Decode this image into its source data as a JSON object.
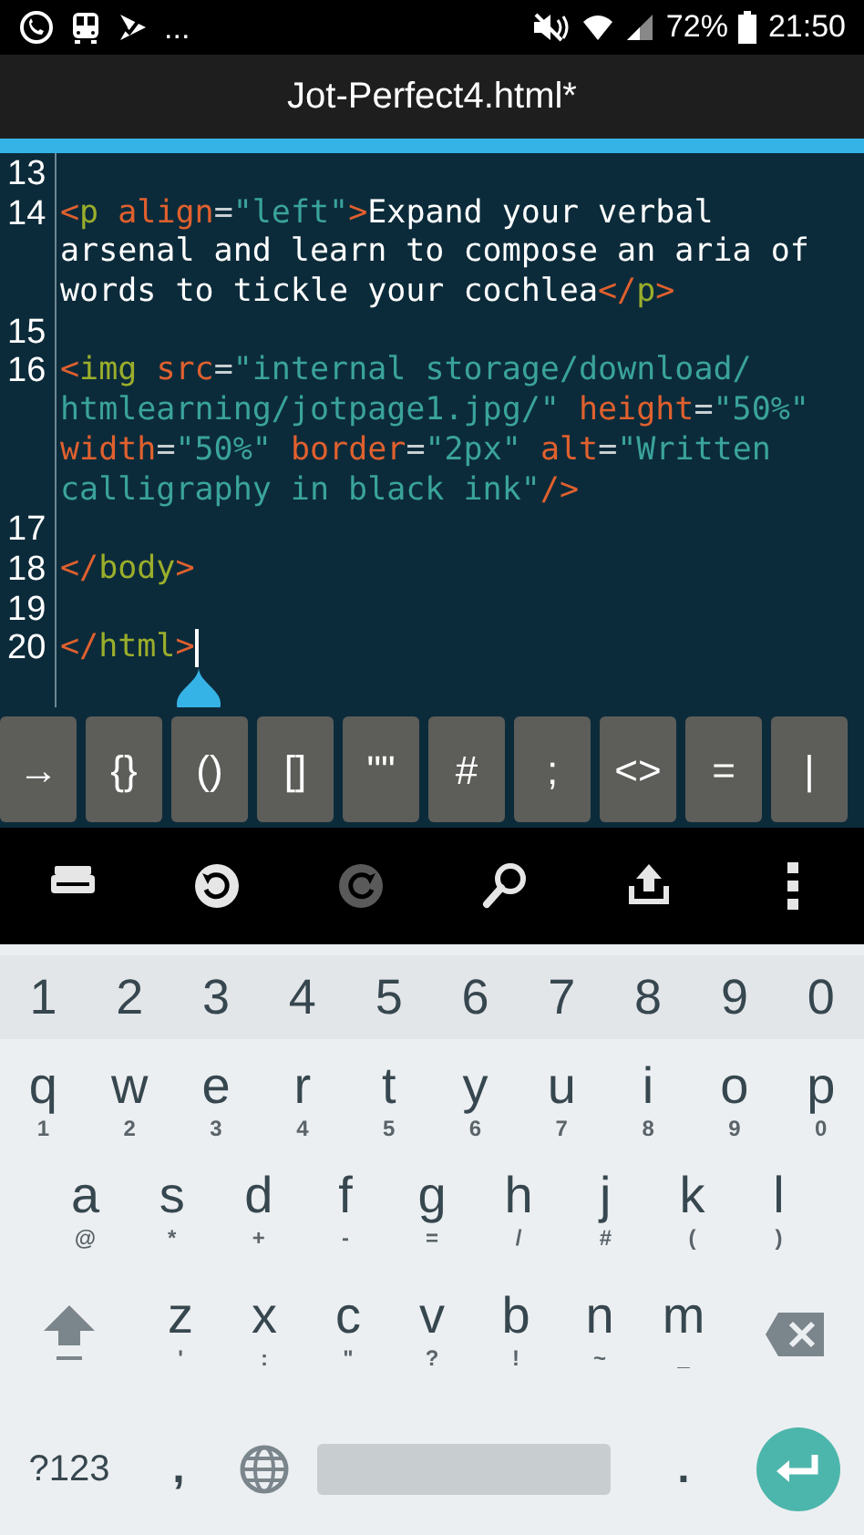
{
  "status_bar": {
    "overflow": "...",
    "battery": "72%",
    "time": "21:50"
  },
  "window": {
    "title": "Jot-Perfect4.html*"
  },
  "editor": {
    "lines": [
      {
        "number": "13"
      },
      {
        "number": "14",
        "wraps": [
          {
            "spans": [
              {
                "kind": "punct",
                "text": "<"
              },
              {
                "kind": "tag",
                "text": "p"
              },
              {
                "kind": "attr",
                "text": " align"
              },
              {
                "kind": "eq",
                "text": "="
              },
              {
                "kind": "value",
                "text": "\"left\""
              },
              {
                "kind": "punct",
                "text": ">"
              },
              {
                "kind": "text",
                "text": "Expand your verbal"
              }
            ]
          },
          {
            "spans": [
              {
                "kind": "text",
                "text": "arsenal and learn to compose an aria of"
              }
            ]
          },
          {
            "spans": [
              {
                "kind": "text",
                "text": "words to tickle your cochlea"
              },
              {
                "kind": "punct",
                "text": "</"
              },
              {
                "kind": "tag",
                "text": "p"
              },
              {
                "kind": "punct",
                "text": ">"
              }
            ]
          }
        ]
      },
      {
        "number": "15"
      },
      {
        "number": "16",
        "wraps": [
          {
            "spans": [
              {
                "kind": "punct",
                "text": "<"
              },
              {
                "kind": "tag",
                "text": "img"
              },
              {
                "kind": "attr",
                "text": " src"
              },
              {
                "kind": "eq",
                "text": "="
              },
              {
                "kind": "value",
                "text": "\"internal storage/download/"
              }
            ]
          },
          {
            "spans": [
              {
                "kind": "value",
                "text": "htmlearning/jotpage1.jpg/\""
              },
              {
                "kind": "attr",
                "text": " height"
              },
              {
                "kind": "eq",
                "text": "="
              },
              {
                "kind": "value",
                "text": "\"50%\""
              }
            ]
          },
          {
            "spans": [
              {
                "kind": "attr",
                "text": "width"
              },
              {
                "kind": "eq",
                "text": "="
              },
              {
                "kind": "value",
                "text": "\"50%\""
              },
              {
                "kind": "attr",
                "text": " border"
              },
              {
                "kind": "eq",
                "text": "="
              },
              {
                "kind": "value",
                "text": "\"2px\""
              },
              {
                "kind": "attr",
                "text": " alt"
              },
              {
                "kind": "eq",
                "text": "="
              },
              {
                "kind": "value",
                "text": "\"Written"
              }
            ]
          },
          {
            "spans": [
              {
                "kind": "value",
                "text": "calligraphy in black ink\""
              },
              {
                "kind": "punct",
                "text": "/>"
              }
            ]
          }
        ]
      },
      {
        "number": "17"
      },
      {
        "number": "18",
        "wraps": [
          {
            "spans": [
              {
                "kind": "punct",
                "text": "</"
              },
              {
                "kind": "tag",
                "text": "body"
              },
              {
                "kind": "punct",
                "text": ">"
              }
            ]
          }
        ]
      },
      {
        "number": "19"
      },
      {
        "number": "20",
        "wraps": [
          {
            "spans": [
              {
                "kind": "punct",
                "text": "</"
              },
              {
                "kind": "tag",
                "text": "html"
              },
              {
                "kind": "punct",
                "text": ">"
              }
            ]
          }
        ],
        "cursor": true
      }
    ]
  },
  "symbol_keys": [
    "→",
    "{}",
    "()",
    "[]",
    "\"\"",
    "#",
    ";",
    "<>",
    "=",
    "|"
  ],
  "toolbar": [
    {
      "kind": "drive",
      "disabled": false
    },
    {
      "kind": "undo",
      "disabled": false
    },
    {
      "kind": "redo",
      "disabled": true
    },
    {
      "kind": "search",
      "disabled": false
    },
    {
      "kind": "share",
      "disabled": false
    },
    {
      "kind": "more",
      "disabled": false
    }
  ],
  "keyboard": {
    "number_row": [
      "1",
      "2",
      "3",
      "4",
      "5",
      "6",
      "7",
      "8",
      "9",
      "0"
    ],
    "rows": [
      [
        {
          "key": "q",
          "hint": "1"
        },
        {
          "key": "w",
          "hint": "2"
        },
        {
          "key": "e",
          "hint": "3"
        },
        {
          "key": "r",
          "hint": "4"
        },
        {
          "key": "t",
          "hint": "5"
        },
        {
          "key": "y",
          "hint": "6"
        },
        {
          "key": "u",
          "hint": "7"
        },
        {
          "key": "i",
          "hint": "8"
        },
        {
          "key": "o",
          "hint": "9"
        },
        {
          "key": "p",
          "hint": "0"
        }
      ],
      [
        {
          "key": "a",
          "hint": "@"
        },
        {
          "key": "s",
          "hint": "*"
        },
        {
          "key": "d",
          "hint": "+"
        },
        {
          "key": "f",
          "hint": "-"
        },
        {
          "key": "g",
          "hint": "="
        },
        {
          "key": "h",
          "hint": "/"
        },
        {
          "key": "j",
          "hint": "#"
        },
        {
          "key": "k",
          "hint": "("
        },
        {
          "key": "l",
          "hint": ")"
        }
      ],
      [
        {
          "key": "z",
          "hint": "'"
        },
        {
          "key": "x",
          "hint": ":"
        },
        {
          "key": "c",
          "hint": "\""
        },
        {
          "key": "v",
          "hint": "?"
        },
        {
          "key": "b",
          "hint": "!"
        },
        {
          "key": "n",
          "hint": "~"
        },
        {
          "key": "m",
          "hint": "_"
        }
      ]
    ],
    "symbols_key": "?123",
    "comma_key": ",",
    "period_key": "."
  }
}
